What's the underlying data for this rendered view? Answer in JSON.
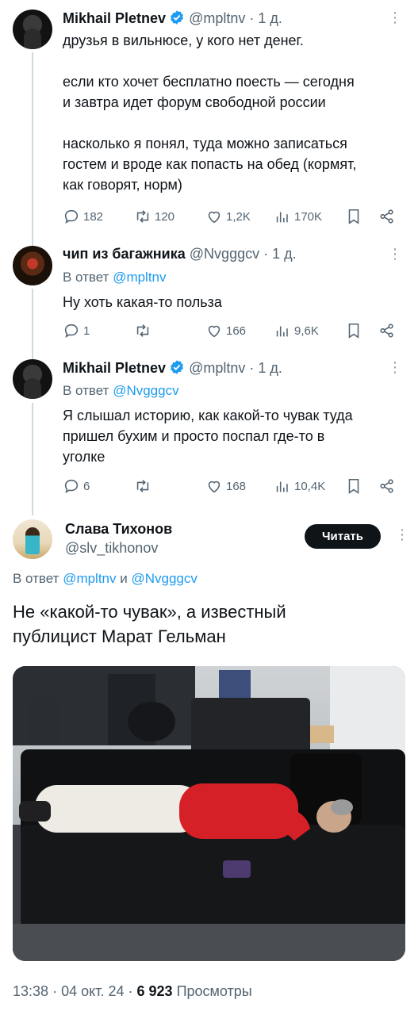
{
  "tweets": [
    {
      "name": "Mikhail Pletnev",
      "handle": "@mpltnv",
      "time": "1 д.",
      "lines": [
        "друзья в вильнюсе, у кого нет денег.",
        "",
        "если кто хочет бесплатно поесть — сегодня",
        "и завтра идет форум свободной россии",
        "",
        "насколько я понял, туда можно записаться",
        "гостем и вроде как попасть на обед (кормят,",
        "как говорят, норм)"
      ],
      "replies": "182",
      "retweets": "120",
      "likes": "1,2K",
      "views": "170K"
    },
    {
      "name": "чип из багажника",
      "handle": "@Nvgggcv",
      "time": "1 д.",
      "reply_label": "В ответ",
      "reply_to": "@mpltnv",
      "lines": [
        "Ну хоть какая-то польза"
      ],
      "replies": "1",
      "retweets": "",
      "likes": "166",
      "views": "9,6K"
    },
    {
      "name": "Mikhail Pletnev",
      "handle": "@mpltnv",
      "time": "1 д.",
      "reply_label": "В ответ",
      "reply_to": "@Nvgggcv",
      "lines": [
        "Я слышал историю, как какой-то чувак туда",
        "пришел бухим и просто поспал где-то в",
        "уголке"
      ],
      "replies": "6",
      "retweets": "",
      "likes": "168",
      "views": "10,4K"
    }
  ],
  "main": {
    "name": "Слава Тихонов",
    "handle": "@slv_tikhonov",
    "follow_label": "Читать",
    "reply_label": "В ответ",
    "reply_to_1": "@mpltnv",
    "reply_and": "и",
    "reply_to_2": "@Nvgggcv",
    "lines": [
      "Не «какой-то чувак», а известный",
      "публицист Марат Гельман"
    ],
    "time": "13:38",
    "date": "04 окт. 24",
    "views_count": "6 923",
    "views_label": "Просмотры"
  },
  "colors": {
    "accent": "#1d9bf0",
    "text": "#0f1419",
    "muted": "#536471",
    "verified": "#1d9bf0"
  },
  "icons": [
    "verified-badge-icon",
    "reply-icon",
    "retweet-icon",
    "like-icon",
    "views-icon",
    "bookmark-icon",
    "share-icon",
    "more-icon"
  ]
}
